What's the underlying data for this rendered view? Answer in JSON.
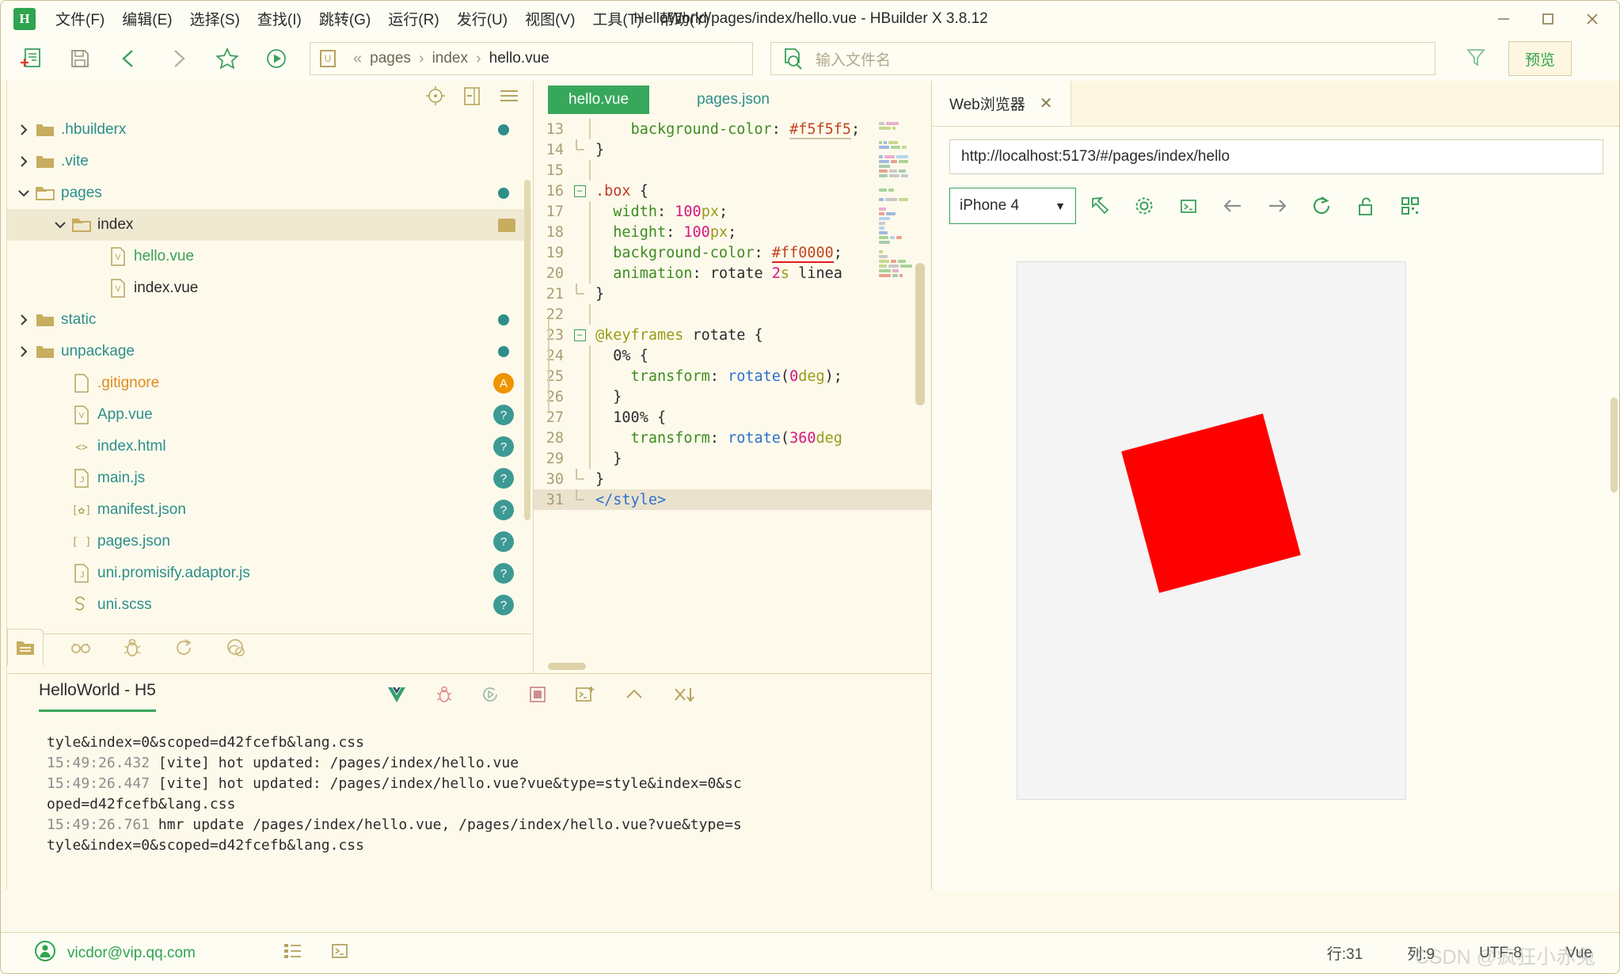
{
  "window": {
    "title": "HelloWorld/pages/index/hello.vue - HBuilder X 3.8.12",
    "logo": "H",
    "minimize": "—",
    "maximize": "□",
    "close": "✕"
  },
  "menu": {
    "items": [
      {
        "label": "文件(F)"
      },
      {
        "label": "编辑(E)"
      },
      {
        "label": "选择(S)"
      },
      {
        "label": "查找(I)"
      },
      {
        "label": "跳转(G)"
      },
      {
        "label": "运行(R)"
      },
      {
        "label": "发行(U)"
      },
      {
        "label": "视图(V)"
      },
      {
        "label": "工具(T)"
      },
      {
        "label": "帮助(Y)"
      }
    ]
  },
  "toolbar": {
    "new_file": "new-file-icon",
    "save": "save-icon",
    "back": "back-icon",
    "forward": "forward-icon",
    "favorite": "star-icon",
    "run": "run-icon",
    "breadcrumb": {
      "root_icon": "U",
      "collapse": "«",
      "parts": [
        "pages",
        "index"
      ],
      "current": "hello.vue"
    },
    "search_placeholder": "输入文件名",
    "filter": "filter-icon",
    "preview_label": "预览"
  },
  "tree": {
    "header_icons": [
      "locate-icon",
      "collapse-all-icon",
      "menu-icon"
    ],
    "items": [
      {
        "label": ".hbuilderx",
        "type": "folder",
        "indent": 1,
        "expanded": false,
        "color": "teal",
        "badge": "dot"
      },
      {
        "label": ".vite",
        "type": "folder",
        "indent": 1,
        "expanded": false,
        "color": "teal",
        "badge": "none"
      },
      {
        "label": "pages",
        "type": "folder-open",
        "indent": 1,
        "expanded": true,
        "color": "teal",
        "badge": "dot"
      },
      {
        "label": "index",
        "type": "folder-open",
        "indent": 2,
        "expanded": true,
        "color": "dark",
        "badge": "folder",
        "selected": true
      },
      {
        "label": "hello.vue",
        "type": "vue",
        "indent": 3,
        "color": "green",
        "badge": "none"
      },
      {
        "label": "index.vue",
        "type": "vue",
        "indent": 3,
        "color": "dark",
        "badge": "none"
      },
      {
        "label": "static",
        "type": "folder",
        "indent": 1,
        "expanded": false,
        "color": "teal",
        "badge": "dot"
      },
      {
        "label": "unpackage",
        "type": "folder",
        "indent": 1,
        "expanded": false,
        "color": "teal",
        "badge": "dot"
      },
      {
        "label": ".gitignore",
        "type": "file",
        "indent": 2,
        "color": "orange",
        "badge": "A"
      },
      {
        "label": "App.vue",
        "type": "vue",
        "indent": 2,
        "color": "teal",
        "badge": "?"
      },
      {
        "label": "index.html",
        "type": "html",
        "indent": 2,
        "color": "teal",
        "badge": "?"
      },
      {
        "label": "main.js",
        "type": "js",
        "indent": 2,
        "color": "teal",
        "badge": "?"
      },
      {
        "label": "manifest.json",
        "type": "manifest",
        "indent": 2,
        "color": "teal",
        "badge": "?"
      },
      {
        "label": "pages.json",
        "type": "json",
        "indent": 2,
        "color": "teal",
        "badge": "?"
      },
      {
        "label": "uni.promisify.adaptor.js",
        "type": "js",
        "indent": 2,
        "color": "teal",
        "badge": "?"
      },
      {
        "label": "uni.scss",
        "type": "scss",
        "indent": 2,
        "color": "teal",
        "badge": "?"
      }
    ],
    "bottom_tabs": [
      "project-icon",
      "search-icon",
      "debug-icon",
      "terminal-run-icon",
      "extension-icon"
    ]
  },
  "editor": {
    "tabs": [
      {
        "label": "hello.vue",
        "active": true
      },
      {
        "label": "pages.json",
        "active": false
      }
    ],
    "lines": [
      {
        "no": "13",
        "fold": "",
        "guide": true,
        "highlight": false,
        "tokens": [
          {
            "t": "    ",
            "c": "plain"
          },
          {
            "t": "background-color",
            "c": "prop"
          },
          {
            "t": ": ",
            "c": "plain"
          },
          {
            "t": "#f5f5f5",
            "c": "hex-ul"
          },
          {
            "t": ";",
            "c": "plain"
          }
        ]
      },
      {
        "no": "14",
        "fold": "end",
        "guide": false,
        "highlight": false,
        "tokens": [
          {
            "t": "}",
            "c": "plain"
          }
        ]
      },
      {
        "no": "15",
        "fold": "",
        "guide": true,
        "highlight": false,
        "tokens": []
      },
      {
        "no": "16",
        "fold": "open",
        "guide": false,
        "highlight": false,
        "tokens": [
          {
            "t": ".box",
            "c": "sel"
          },
          {
            "t": " {",
            "c": "plain"
          }
        ]
      },
      {
        "no": "17",
        "fold": "",
        "guide": true,
        "highlight": false,
        "tokens": [
          {
            "t": "  ",
            "c": "plain"
          },
          {
            "t": "width",
            "c": "prop"
          },
          {
            "t": ": ",
            "c": "plain"
          },
          {
            "t": "100",
            "c": "num"
          },
          {
            "t": "px",
            "c": "unit"
          },
          {
            "t": ";",
            "c": "plain"
          }
        ]
      },
      {
        "no": "18",
        "fold": "",
        "guide": true,
        "highlight": false,
        "tokens": [
          {
            "t": "  ",
            "c": "plain"
          },
          {
            "t": "height",
            "c": "prop"
          },
          {
            "t": ": ",
            "c": "plain"
          },
          {
            "t": "100",
            "c": "num"
          },
          {
            "t": "px",
            "c": "unit"
          },
          {
            "t": ";",
            "c": "plain"
          }
        ]
      },
      {
        "no": "19",
        "fold": "",
        "guide": true,
        "highlight": false,
        "tokens": [
          {
            "t": "  ",
            "c": "plain"
          },
          {
            "t": "background-color",
            "c": "prop"
          },
          {
            "t": ": ",
            "c": "plain"
          },
          {
            "t": "#ff0000",
            "c": "hex-u"
          },
          {
            "t": ";",
            "c": "plain"
          }
        ]
      },
      {
        "no": "20",
        "fold": "",
        "guide": true,
        "highlight": false,
        "tokens": [
          {
            "t": "  ",
            "c": "plain"
          },
          {
            "t": "animation",
            "c": "prop"
          },
          {
            "t": ": ",
            "c": "plain"
          },
          {
            "t": "rotate ",
            "c": "plain"
          },
          {
            "t": "2",
            "c": "num"
          },
          {
            "t": "s",
            "c": "unit"
          },
          {
            "t": " linea",
            "c": "plain"
          }
        ]
      },
      {
        "no": "21",
        "fold": "end",
        "guide": false,
        "highlight": false,
        "tokens": [
          {
            "t": "}",
            "c": "plain"
          }
        ]
      },
      {
        "no": "22",
        "fold": "",
        "guide": true,
        "highlight": false,
        "tokens": []
      },
      {
        "no": "23",
        "fold": "open",
        "guide": false,
        "highlight": false,
        "tokens": [
          {
            "t": "@keyframes",
            "c": "at"
          },
          {
            "t": " rotate {",
            "c": "plain"
          }
        ]
      },
      {
        "no": "24",
        "fold": "",
        "guide": true,
        "highlight": false,
        "tokens": [
          {
            "t": "  ",
            "c": "plain"
          },
          {
            "t": "0",
            "c": "num2"
          },
          {
            "t": "% {",
            "c": "plain"
          }
        ]
      },
      {
        "no": "25",
        "fold": "",
        "guide": true,
        "highlight": false,
        "tokens": [
          {
            "t": "    ",
            "c": "plain"
          },
          {
            "t": "transform",
            "c": "prop"
          },
          {
            "t": ": ",
            "c": "plain"
          },
          {
            "t": "rotate",
            "c": "fn"
          },
          {
            "t": "(",
            "c": "plain"
          },
          {
            "t": "0",
            "c": "num"
          },
          {
            "t": "deg",
            "c": "unit"
          },
          {
            "t": ");",
            "c": "plain"
          }
        ]
      },
      {
        "no": "26",
        "fold": "",
        "guide": true,
        "highlight": false,
        "tokens": [
          {
            "t": "  }",
            "c": "plain"
          }
        ]
      },
      {
        "no": "27",
        "fold": "",
        "guide": true,
        "highlight": false,
        "tokens": [
          {
            "t": "  ",
            "c": "plain"
          },
          {
            "t": "100",
            "c": "num2"
          },
          {
            "t": "% {",
            "c": "plain"
          }
        ]
      },
      {
        "no": "28",
        "fold": "",
        "guide": true,
        "highlight": false,
        "tokens": [
          {
            "t": "    ",
            "c": "plain"
          },
          {
            "t": "transform",
            "c": "prop"
          },
          {
            "t": ": ",
            "c": "plain"
          },
          {
            "t": "rotate",
            "c": "fn"
          },
          {
            "t": "(",
            "c": "plain"
          },
          {
            "t": "360",
            "c": "num"
          },
          {
            "t": "deg",
            "c": "unit"
          }
        ]
      },
      {
        "no": "29",
        "fold": "",
        "guide": true,
        "highlight": false,
        "tokens": [
          {
            "t": "  }",
            "c": "plain"
          }
        ]
      },
      {
        "no": "30",
        "fold": "end",
        "guide": false,
        "highlight": false,
        "tokens": [
          {
            "t": "}",
            "c": "plain"
          }
        ]
      },
      {
        "no": "31",
        "fold": "endlast",
        "guide": false,
        "highlight": true,
        "tokens": [
          {
            "t": "</style>",
            "c": "tag"
          }
        ]
      }
    ]
  },
  "console": {
    "title": "HelloWorld - H5",
    "tools": [
      "vue-icon",
      "bug-icon",
      "rerun-icon",
      "stop-icon",
      "new-terminal-icon",
      "collapse-icon",
      "clear-icon"
    ],
    "logs": [
      {
        "ts": "",
        "text": "tyle&index=0&scoped=d42fcefb&lang.css"
      },
      {
        "ts": "15:49:26.432",
        "text": " [vite] hot updated: /pages/index/hello.vue"
      },
      {
        "ts": "15:49:26.447",
        "text": " [vite] hot updated: /pages/index/hello.vue?vue&type=style&index=0&sc"
      },
      {
        "ts": "",
        "text": "oped=d42fcefb&lang.css"
      },
      {
        "ts": "15:49:26.761",
        "text": " hmr update /pages/index/hello.vue, /pages/index/hello.vue?vue&type=s"
      },
      {
        "ts": "",
        "text": "tyle&index=0&scoped=d42fcefb&lang.css"
      }
    ]
  },
  "browser": {
    "tab_label": "Web浏览器",
    "tab_close": "✕",
    "url": "http://localhost:5173/#/pages/index/hello",
    "device": "iPhone 4",
    "device_caret": "▼",
    "icons": [
      "open-external-icon",
      "settings-icon",
      "console-icon",
      "back-icon",
      "forward-icon",
      "reload-icon",
      "unlock-icon",
      "qrcode-icon"
    ],
    "preview_box_color": "#fe0000",
    "preview_box_rotation": "-15deg"
  },
  "status": {
    "email": "vicdor@vip.qq.com",
    "icons": [
      "outline-icon",
      "terminal-icon"
    ],
    "line": "行:31",
    "column": "列:9",
    "encoding": "UTF-8",
    "language": "Vue",
    "watermark": "CSDN @疯狂小赤兔"
  }
}
